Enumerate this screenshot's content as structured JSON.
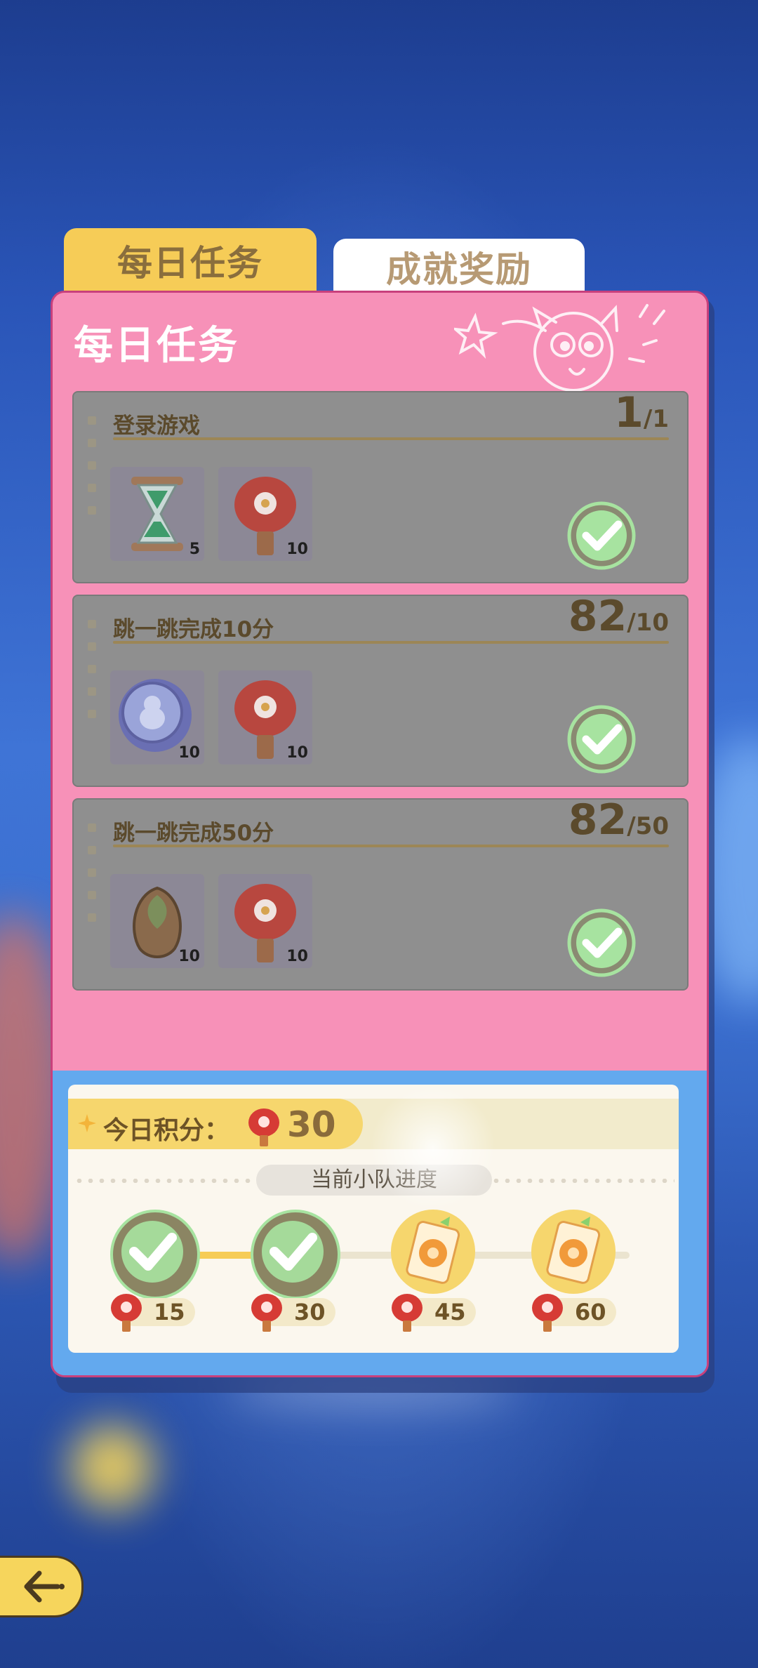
{
  "tabs": [
    {
      "label": "每日任务",
      "active": true
    },
    {
      "label": "成就奖励",
      "active": false
    }
  ],
  "panel": {
    "title": "每日任务"
  },
  "tasks": [
    {
      "title": "登录游戏",
      "current": "1",
      "target": "/1",
      "rewards": [
        {
          "icon": "hourglass-icon",
          "qty": "5"
        },
        {
          "icon": "lantern-icon",
          "qty": "10"
        }
      ],
      "completed": true
    },
    {
      "title": "跳一跳完成10分",
      "current": "82",
      "target": "/10",
      "rewards": [
        {
          "icon": "coin-icon",
          "qty": "10"
        },
        {
          "icon": "lantern-icon",
          "qty": "10"
        }
      ],
      "completed": true
    },
    {
      "title": "跳一跳完成50分",
      "current": "82",
      "target": "/50",
      "rewards": [
        {
          "icon": "seed-icon",
          "qty": "10"
        },
        {
          "icon": "lantern-icon",
          "qty": "10"
        }
      ],
      "completed": true
    }
  ],
  "score": {
    "label": "今日积分：",
    "value": "30"
  },
  "team": {
    "label": "当前小队进度",
    "progress": 0.34
  },
  "milestones": [
    {
      "value": "15",
      "state": "claimed"
    },
    {
      "value": "30",
      "state": "claimed"
    },
    {
      "value": "45",
      "state": "locked"
    },
    {
      "value": "60",
      "state": "locked"
    }
  ],
  "colors": {
    "panel": "#f791b8",
    "accent": "#f6cc57",
    "bottom": "#63a9ee",
    "check": "#a7e3a0"
  }
}
